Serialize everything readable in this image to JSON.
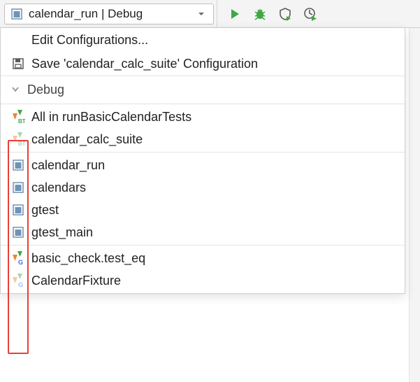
{
  "toolbar": {
    "selected_config": "calendar_run | Debug"
  },
  "menu": {
    "edit_configs": "Edit Configurations...",
    "save_config": "Save 'calendar_calc_suite' Configuration"
  },
  "section_header": "Debug",
  "groups": [
    {
      "type": "bt",
      "items": [
        {
          "label": "All in runBasicCalendarTests",
          "fade": false
        },
        {
          "label": "calendar_calc_suite",
          "fade": true
        }
      ]
    },
    {
      "type": "app",
      "items": [
        {
          "label": "calendar_run",
          "fade": false
        },
        {
          "label": "calendars",
          "fade": false
        },
        {
          "label": "gtest",
          "fade": false
        },
        {
          "label": "gtest_main",
          "fade": false
        }
      ]
    },
    {
      "type": "gt",
      "items": [
        {
          "label": "basic_check.test_eq",
          "fade": false
        },
        {
          "label": "CalendarFixture",
          "fade": true
        }
      ]
    }
  ]
}
